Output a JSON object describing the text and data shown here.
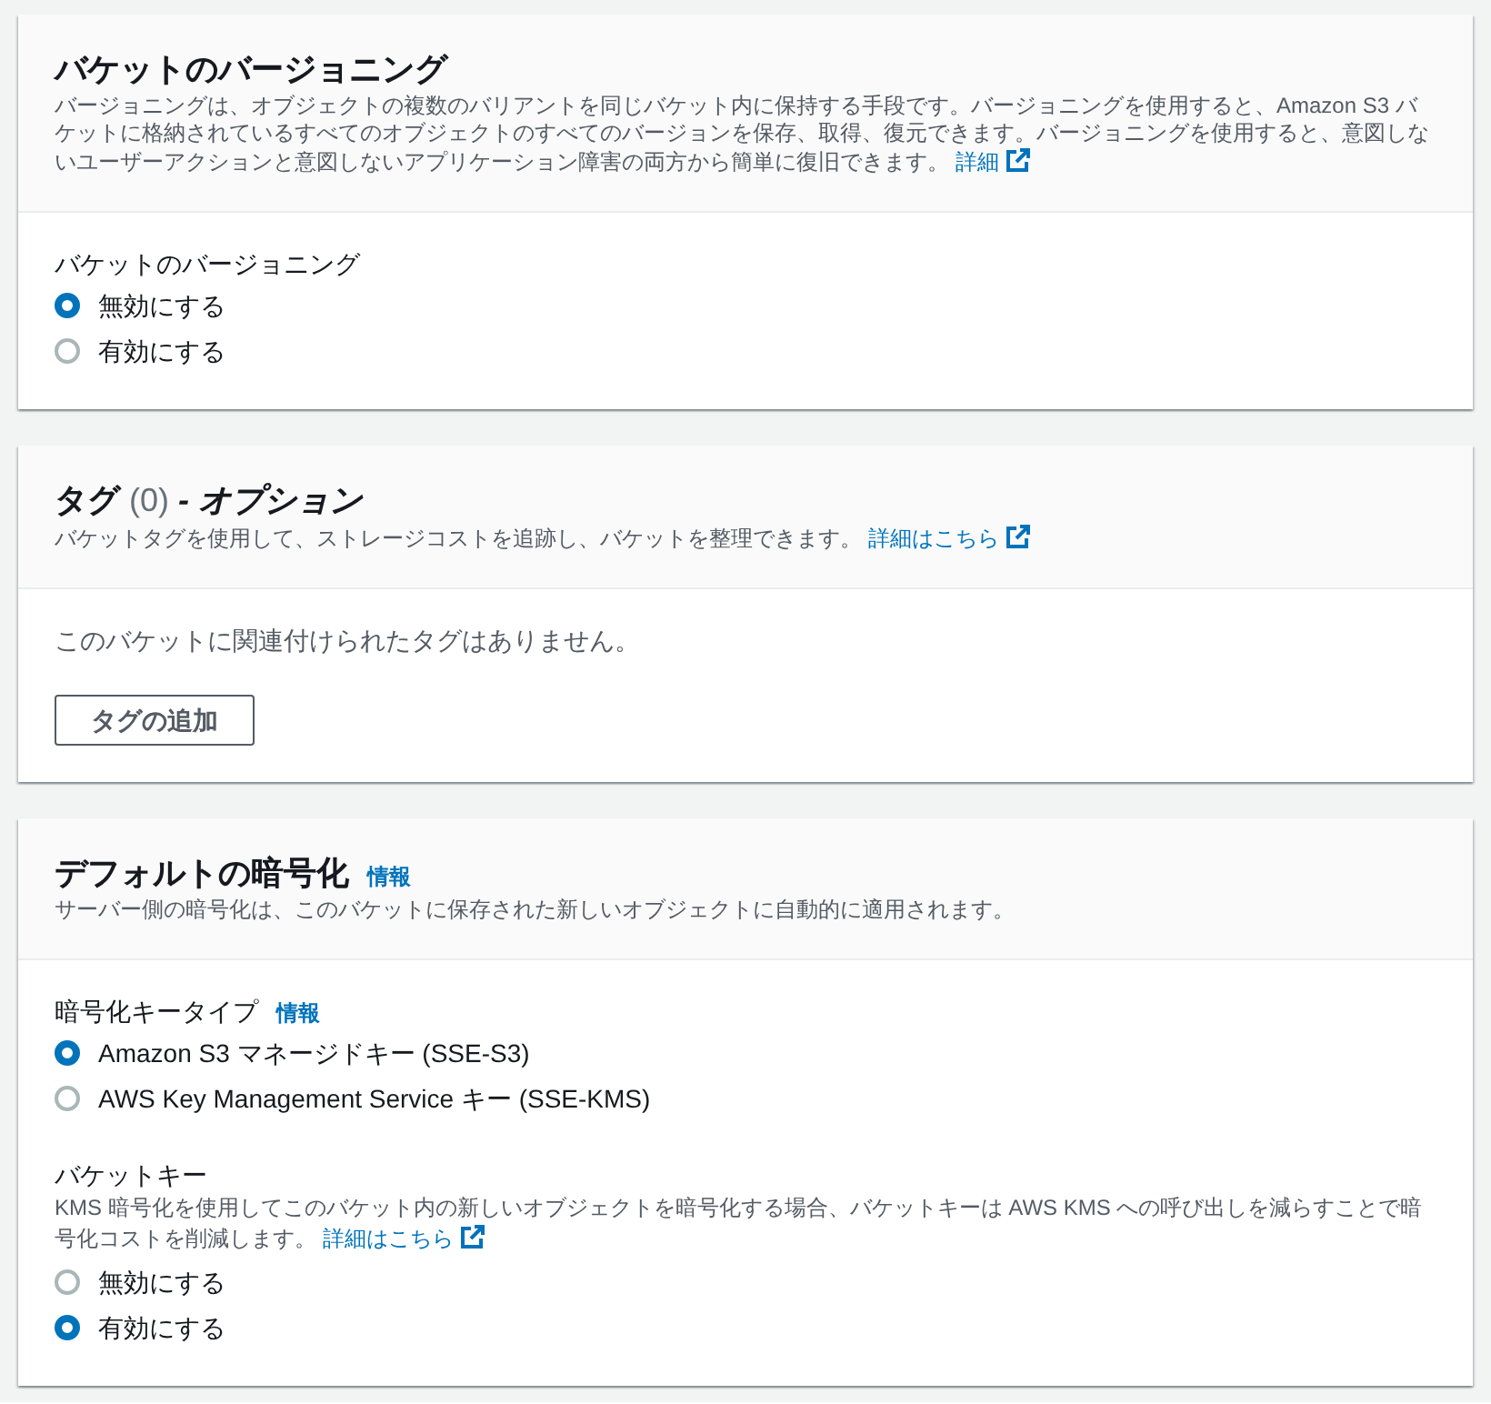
{
  "sections": [
    {
      "title": "バケットのバージョニング",
      "description": "バージョニングは、オブジェクトの複数のバリアントを同じバケット内に保持する手段です。バージョニングを使用すると、Amazon S3 バケットに格納されているすべてのオブジェクトのすべてのバージョンを保存、取得、復元できます。バージョニングを使用すると、意図しないユーザーアクションと意図しないアプリケーション障害の両方から簡単に復旧できます。",
      "link": "詳細",
      "body": [
        {
          "kind": "radio_group",
          "label": "バケットのバージョニング",
          "options": [
            {
              "label": "無効にする",
              "selected": true
            },
            {
              "label": "有効にする",
              "selected": false
            }
          ]
        }
      ]
    },
    {
      "title": "タグ",
      "counter": "(0)",
      "title_suffix": "- オプション",
      "description": "バケットタグを使用して、ストレージコストを追跡し、バケットを整理できます。",
      "link": "詳細はこちら",
      "body": [
        {
          "kind": "note",
          "text": "このバケットに関連付けられたタグはありません。"
        },
        {
          "kind": "button",
          "label": "タグの追加"
        }
      ]
    },
    {
      "title": "デフォルトの暗号化",
      "info": "情報",
      "description": "サーバー側の暗号化は、このバケットに保存された新しいオブジェクトに自動的に適用されます。",
      "body": [
        {
          "kind": "radio_group",
          "label": "暗号化キータイプ",
          "info": "情報",
          "options": [
            {
              "label": "Amazon S3 マネージドキー (SSE-S3)",
              "selected": true
            },
            {
              "label": "AWS Key Management Service キー (SSE-KMS)",
              "selected": false
            }
          ]
        },
        {
          "kind": "radio_group",
          "label": "バケットキー",
          "description": "KMS 暗号化を使用してこのバケット内の新しいオブジェクトを暗号化する場合、バケットキーは AWS KMS への呼び出しを減らすことで暗号化コストを削減します。",
          "link": "詳細はこちら",
          "options": [
            {
              "label": "無効にする",
              "selected": false
            },
            {
              "label": "有効にする",
              "selected": true
            }
          ]
        }
      ]
    }
  ]
}
